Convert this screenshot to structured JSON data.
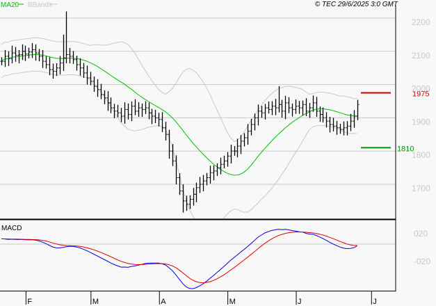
{
  "header": {
    "legend_ma": "MA20",
    "legend_bbands": "BBands",
    "copyright": "© TEC 29/6/2025 3:0 GMT",
    "macd_label": "MACD"
  },
  "colors": {
    "ma": "#00c000",
    "bbands": "#c8c8c8",
    "resistance": "#cc0000",
    "support": "#009000",
    "macd": "#0000dd",
    "signal": "#dd0000",
    "bars": "#000000"
  },
  "chart_data": {
    "type": "ohlc",
    "title": "",
    "price_axis": {
      "ylim": [
        1590,
        2250
      ],
      "ticks": [
        "2200",
        "2100",
        "2000",
        "1900",
        "1800",
        "1700"
      ],
      "tick_values": [
        2200,
        2100,
        2000,
        1900,
        1800,
        1700
      ]
    },
    "macd_axis": {
      "ylim": [
        -80,
        45
      ],
      "ticks": [
        "020",
        "-020"
      ],
      "tick_values": [
        20,
        -20
      ]
    },
    "months": [
      {
        "label": "F",
        "bar": 8
      },
      {
        "label": "M",
        "bar": 27
      },
      {
        "label": "A",
        "bar": 47
      },
      {
        "label": "M",
        "bar": 67
      },
      {
        "label": "J",
        "bar": 87
      },
      {
        "label": "J",
        "bar": 109
      }
    ],
    "closes": [
      2070,
      2085,
      2078,
      2095,
      2088,
      2090,
      2100,
      2092,
      2098,
      2105,
      2095,
      2085,
      2070,
      2060,
      2045,
      2040,
      2050,
      2065,
      2080,
      2090,
      2085,
      2075,
      2060,
      2050,
      2035,
      2020,
      2010,
      1995,
      1985,
      1970,
      1960,
      1945,
      1930,
      1920,
      1915,
      1905,
      1925,
      1910,
      1935,
      1920,
      1930,
      1925,
      1930,
      1915,
      1905,
      1900,
      1895,
      1870,
      1850,
      1800,
      1770,
      1720,
      1680,
      1650,
      1640,
      1655,
      1670,
      1690,
      1700,
      1710,
      1720,
      1735,
      1740,
      1750,
      1760,
      1770,
      1785,
      1800,
      1800,
      1815,
      1830,
      1840,
      1860,
      1880,
      1900,
      1920,
      1915,
      1930,
      1925,
      1935,
      1930,
      1940,
      1920,
      1945,
      1930,
      1925,
      1935,
      1930,
      1940,
      1920,
      1930,
      1945,
      1920,
      1910,
      1900,
      1890,
      1880,
      1875,
      1870,
      1865,
      1870,
      1875,
      1890,
      1905,
      1940
    ],
    "high_overrides": {
      "19": 2220,
      "18": 2150,
      "81": 1995,
      "53": 1700
    },
    "low_overrides": {
      "53": 1615,
      "54": 1620
    },
    "indicators": [
      "MA20",
      "Bollinger Bands (20,2)",
      "MACD (12,26,9)"
    ],
    "levels": [
      {
        "label": "1975",
        "value": 1975,
        "kind": "resistance"
      },
      {
        "label": "1810",
        "value": 1810,
        "kind": "support"
      }
    ]
  }
}
